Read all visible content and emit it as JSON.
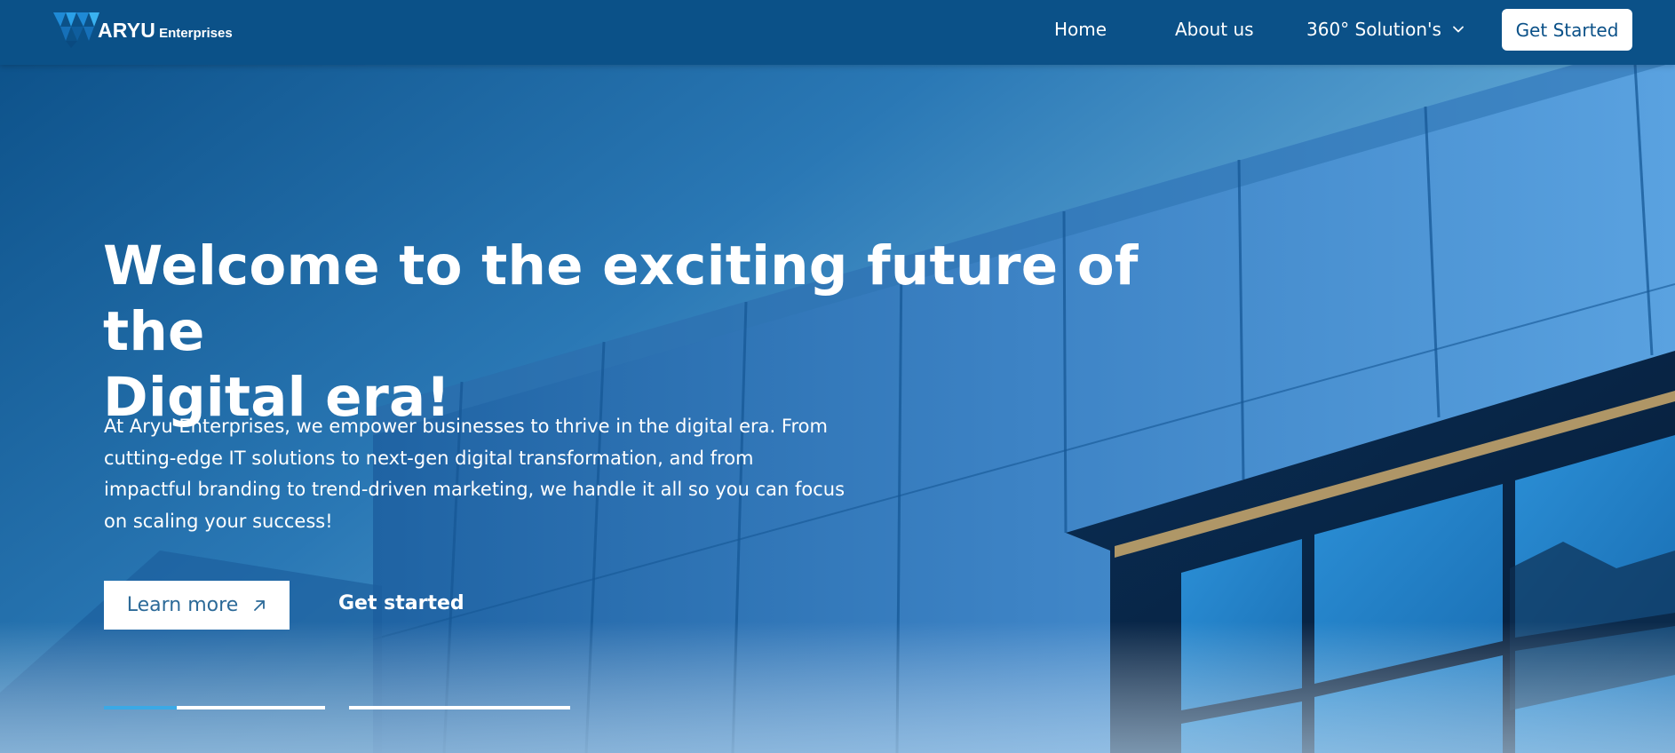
{
  "header": {
    "logo_text": "ARYU",
    "logo_sub": "Enterprises",
    "nav": {
      "home": "Home",
      "about": "About us",
      "solutions": "360° Solution's"
    },
    "cta": "Get Started"
  },
  "hero": {
    "title_line1": "Welcome to the exciting future of the",
    "title_line2": "Digital era!",
    "description_line1": "At Aryu Enterprises, we empower businesses to thrive in the digital era. From",
    "description_line2": "cutting-edge IT solutions to next-gen digital transformation, and from",
    "description_line3": "impactful branding to trend-driven marketing, we handle it all so you can focus",
    "description_line4": "on scaling your success!",
    "learn_more": "Learn more",
    "get_started": "Get started"
  },
  "slider": {
    "slides": 2,
    "active_slide": 1,
    "active_progress": 0.33
  },
  "colors": {
    "header_bg": "#0b5188",
    "accent": "#3aa9e6",
    "button_text": "#2c6a98"
  },
  "icons": [
    "logo-mark-icon",
    "chevron-down-icon",
    "arrow-up-right-icon"
  ]
}
